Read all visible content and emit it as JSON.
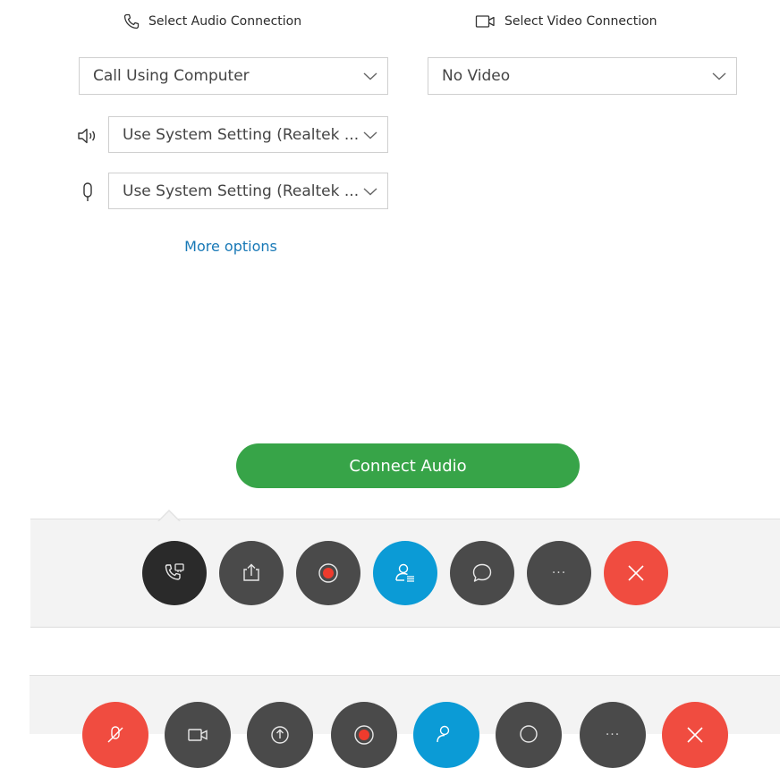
{
  "audio_section": {
    "heading": "Select Audio Connection",
    "connection_value": "Call Using Computer",
    "speaker_value": "Use System Setting (Realtek ...",
    "microphone_value": "Use System Setting (Realtek ..."
  },
  "video_section": {
    "heading": "Select Video Connection",
    "connection_value": "No Video"
  },
  "more_options_label": "More options",
  "connect_audio_label": "Connect Audio",
  "toolbar": {
    "more_label": "···"
  },
  "colors": {
    "accent_green": "#37a448",
    "link_blue": "#1778b6",
    "participants_blue": "#0b9bd6",
    "end_red": "#f04c40",
    "button_dark": "#4a4a4a"
  },
  "icons": {
    "audio_heading": "phone-icon",
    "video_heading": "video-camera-icon",
    "speaker": "speaker-icon",
    "microphone": "microphone-icon",
    "toolbar_buttons": [
      "audio-connection-icon",
      "share-icon",
      "record-icon",
      "participants-icon",
      "chat-icon",
      "more-icon",
      "close-icon"
    ]
  }
}
